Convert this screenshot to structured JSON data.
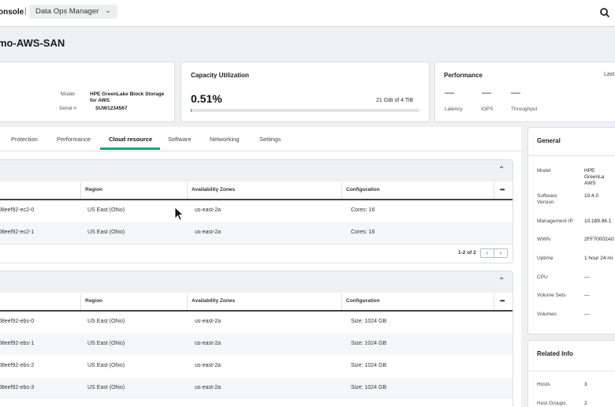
{
  "topbar": {
    "console": "onsole",
    "separator": "|",
    "app_menu": "Data Ops Manager",
    "app_menu_chevron": "⌄",
    "search_icon": "search-icon"
  },
  "page_title": "mo-AWS-SAN",
  "system_card": {
    "model_label": "Model",
    "model_value": "HPE GreenLake Block Storage for AWS",
    "serial_label": "Serial #",
    "serial_value": "SUW1234567"
  },
  "capacity_card": {
    "title": "Capacity Utilization",
    "percent": "0.51%",
    "used_text": "21 GiB of 4 TiB",
    "fill_fraction": 0.0051
  },
  "performance_card": {
    "title": "Performance",
    "last": "Last",
    "latency_value": "—",
    "latency_label": "Latency",
    "iops_value": "—",
    "iops_label": "IOPS",
    "throughput_value": "—",
    "throughput_label": "Throughput"
  },
  "tabs": [
    "Protection",
    "Performance",
    "Cloud resource",
    "Software",
    "Networking",
    "Settings"
  ],
  "active_tab": "Cloud resource",
  "table1": {
    "columns": [
      "Region",
      "Availability Zones",
      "Configuration"
    ],
    "rows": [
      {
        "name": "08eef92-ec2-0",
        "region": "US East (Ohio)",
        "az": "us-east-2a",
        "config": "Cores: 16"
      },
      {
        "name": "08eef92-ec2-1",
        "region": "US East (Ohio)",
        "az": "us-east-2a",
        "config": "Cores: 16"
      }
    ],
    "pager": "1-2 of 2",
    "prev": "‹",
    "next": "›"
  },
  "table2": {
    "columns": [
      "Region",
      "Availability Zones",
      "Configuration"
    ],
    "rows": [
      {
        "name": "08eef92-ebs-0",
        "region": "US East (Ohio)",
        "az": "us-east-2a",
        "config": "Size: 1024 GB"
      },
      {
        "name": "08eef92-ebs-1",
        "region": "US East (Ohio)",
        "az": "us-east-2a",
        "config": "Size: 1024 GB"
      },
      {
        "name": "08eef92-ebs-2",
        "region": "US East (Ohio)",
        "az": "us-east-2a",
        "config": "Size: 1024 GB"
      },
      {
        "name": "08eef92-ebs-3",
        "region": "US East (Ohio)",
        "az": "us-east-2a",
        "config": "Size: 1024 GB"
      }
    ]
  },
  "more_icon": "•••",
  "collapse_icon": "⌃",
  "general": {
    "title": "General",
    "items": [
      {
        "label": "Model",
        "value": "HPE GreenLa AWS"
      },
      {
        "label": "Software Version",
        "value": "10.4.0"
      },
      {
        "label": "Management IP",
        "value": "10.189.96.1"
      },
      {
        "label": "WWN",
        "value": "2FF70002A0"
      },
      {
        "label": "Uptime",
        "value": "1 hour 24 mi"
      },
      {
        "label": "CPU",
        "value": "—"
      },
      {
        "label": "Volume Sets",
        "value": "—"
      },
      {
        "label": "Volumes",
        "value": "—"
      }
    ]
  },
  "related": {
    "title": "Related Info",
    "items": [
      {
        "label": "Hosts",
        "value": "3"
      },
      {
        "label": "Host Groups",
        "value": "2"
      }
    ]
  },
  "colors": {
    "accent": "#01a982",
    "page_bg": "#eef0f2"
  }
}
